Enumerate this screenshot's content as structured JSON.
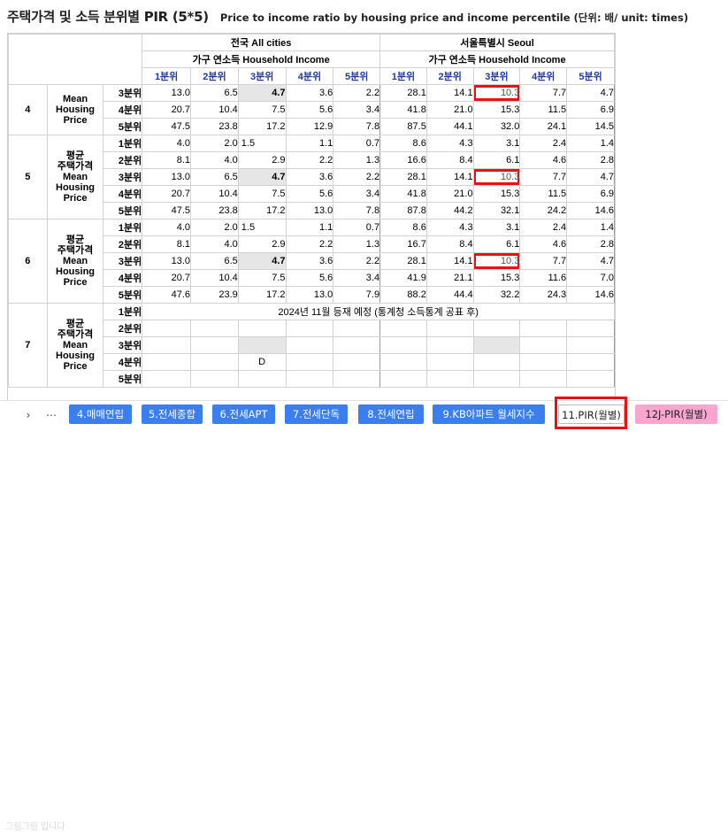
{
  "title": {
    "kr": "주택가격 및 소득 분위별 PIR (5*5)",
    "en": "Price to income ratio by housing price and income percentile  (단위: 배/ unit: times)"
  },
  "header": {
    "national": "전국 All cities",
    "seoul": "서울특별시 Seoul",
    "income_label": "가구 연소득 Household Income",
    "quintiles": [
      "1분위",
      "2분위",
      "3분위",
      "4분위",
      "5분위"
    ]
  },
  "row_label": "평균\n주택가격\nMean\nHousing\nPrice",
  "row_label_short": "Mean\nHousing\nPrice",
  "blocks": [
    {
      "group": "4",
      "label_key": "short",
      "rows": [
        {
          "q": "3분위",
          "national": [
            "13.0",
            "6.5",
            "4.7",
            "3.6",
            "2.2"
          ],
          "seoul": [
            "28.1",
            "14.1",
            "10.3",
            "7.7",
            "4.7"
          ]
        },
        {
          "q": "4분위",
          "national": [
            "20.7",
            "10.4",
            "7.5",
            "5.6",
            "3.4"
          ],
          "seoul": [
            "41.8",
            "21.0",
            "15.3",
            "11.5",
            "6.9"
          ]
        },
        {
          "q": "5분위",
          "national": [
            "47.5",
            "23.8",
            "17.2",
            "12.9",
            "7.8"
          ],
          "seoul": [
            "87.5",
            "44.1",
            "32.0",
            "24.1",
            "14.5"
          ]
        }
      ]
    },
    {
      "group": "5",
      "label_key": "full",
      "rows": [
        {
          "q": "1분위",
          "national": [
            "4.0",
            "2.0",
            "1.5",
            "1.1",
            "0.7"
          ],
          "seoul": [
            "8.6",
            "4.3",
            "3.1",
            "2.4",
            "1.4"
          ]
        },
        {
          "q": "2분위",
          "national": [
            "8.1",
            "4.0",
            "2.9",
            "2.2",
            "1.3"
          ],
          "seoul": [
            "16.6",
            "8.4",
            "6.1",
            "4.6",
            "2.8"
          ]
        },
        {
          "q": "3분위",
          "national": [
            "13.0",
            "6.5",
            "4.7",
            "3.6",
            "2.2"
          ],
          "seoul": [
            "28.1",
            "14.1",
            "10.3",
            "7.7",
            "4.7"
          ]
        },
        {
          "q": "4분위",
          "national": [
            "20.7",
            "10.4",
            "7.5",
            "5.6",
            "3.4"
          ],
          "seoul": [
            "41.8",
            "21.0",
            "15.3",
            "11.5",
            "6.9"
          ]
        },
        {
          "q": "5분위",
          "national": [
            "47.5",
            "23.8",
            "17.2",
            "13.0",
            "7.8"
          ],
          "seoul": [
            "87.8",
            "44.2",
            "32.1",
            "24.2",
            "14.6"
          ]
        }
      ]
    },
    {
      "group": "6",
      "label_key": "full",
      "rows": [
        {
          "q": "1분위",
          "national": [
            "4.0",
            "2.0",
            "1.5",
            "1.1",
            "0.7"
          ],
          "seoul": [
            "8.6",
            "4.3",
            "3.1",
            "2.4",
            "1.4"
          ]
        },
        {
          "q": "2분위",
          "national": [
            "8.1",
            "4.0",
            "2.9",
            "2.2",
            "1.3"
          ],
          "seoul": [
            "16.7",
            "8.4",
            "6.1",
            "4.6",
            "2.8"
          ]
        },
        {
          "q": "3분위",
          "national": [
            "13.0",
            "6.5",
            "4.7",
            "3.6",
            "2.2"
          ],
          "seoul": [
            "28.1",
            "14.1",
            "10.3",
            "7.7",
            "4.7"
          ]
        },
        {
          "q": "4분위",
          "national": [
            "20.7",
            "10.4",
            "7.5",
            "5.6",
            "3.4"
          ],
          "seoul": [
            "41.9",
            "21.1",
            "15.3",
            "11.6",
            "7.0"
          ]
        },
        {
          "q": "5분위",
          "national": [
            "47.6",
            "23.9",
            "17.2",
            "13.0",
            "7.9"
          ],
          "seoul": [
            "88.2",
            "44.4",
            "32.2",
            "24.3",
            "14.6"
          ]
        }
      ]
    }
  ],
  "pending_block": {
    "group": "7",
    "note": "2024년 11월 등재 예정 (통계청 소득통계 공표 후)",
    "d_mark": "D",
    "rows": [
      "1분위",
      "2분위",
      "3분위",
      "4분위",
      "5분위"
    ]
  },
  "tabs": [
    {
      "label": "4.매매연립",
      "style": "blue"
    },
    {
      "label": "5.전세종합",
      "style": "blue"
    },
    {
      "label": "6.전세APT",
      "style": "blue"
    },
    {
      "label": "7.전세단독",
      "style": "blue"
    },
    {
      "label": "8.전세연립",
      "style": "blue"
    },
    {
      "label": "9.KB아파트 월세지수",
      "style": "blue"
    },
    {
      "label": "11.PIR(월별)",
      "style": "active"
    },
    {
      "label": "12J-PIR(월별)",
      "style": "pink"
    }
  ],
  "nav": {
    "next": "›",
    "more": "⋯"
  },
  "watermark": "그림그림 입니다"
}
